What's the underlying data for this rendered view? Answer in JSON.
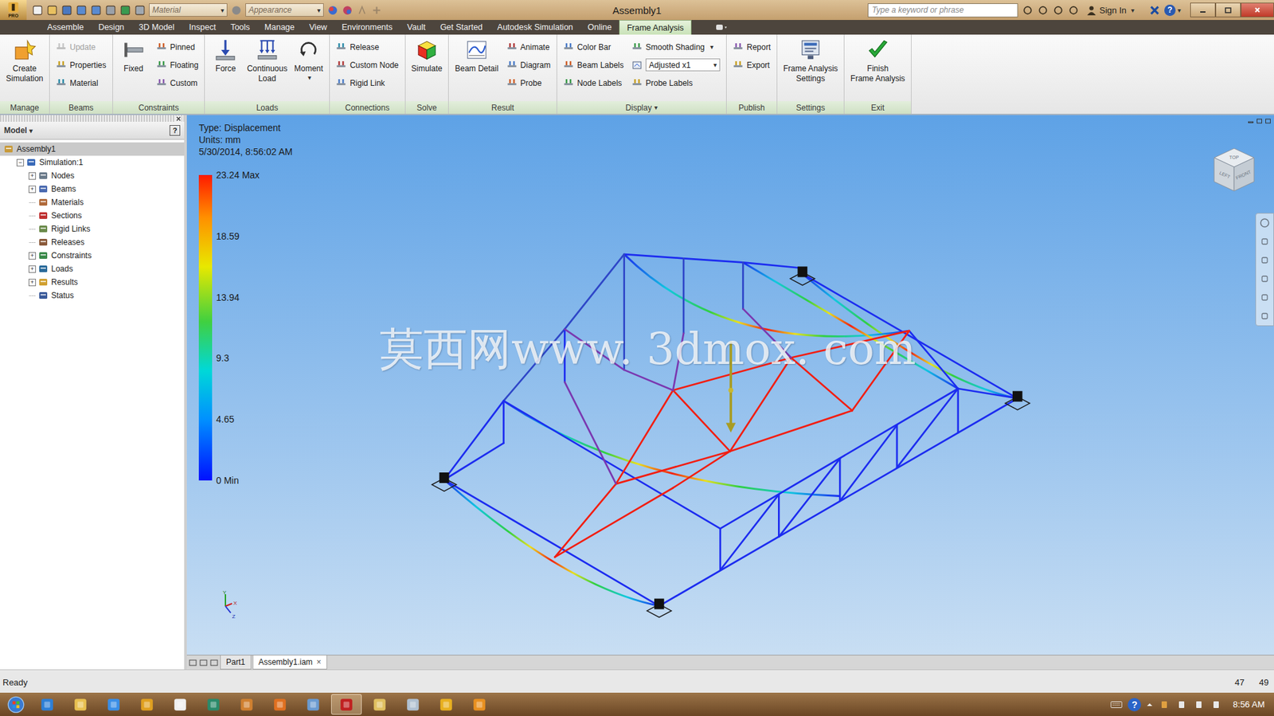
{
  "window": {
    "title": "Assembly1",
    "app_badge": "PRO"
  },
  "quick_access": {
    "material": "Material",
    "appearance": "Appearance",
    "dropdown": "▾"
  },
  "search": {
    "placeholder": "Type a keyword or phrase"
  },
  "account": {
    "sign_in": "Sign In",
    "help": "?",
    "dropdown": "▾"
  },
  "tabs": [
    {
      "label": "Assemble",
      "selected": false
    },
    {
      "label": "Design",
      "selected": false
    },
    {
      "label": "3D Model",
      "selected": false
    },
    {
      "label": "Inspect",
      "selected": false
    },
    {
      "label": "Tools",
      "selected": false
    },
    {
      "label": "Manage",
      "selected": false
    },
    {
      "label": "View",
      "selected": false
    },
    {
      "label": "Environments",
      "selected": false
    },
    {
      "label": "Vault",
      "selected": false
    },
    {
      "label": "Get Started",
      "selected": false
    },
    {
      "label": "Autodesk Simulation",
      "selected": false
    },
    {
      "label": "Online",
      "selected": false
    },
    {
      "label": "Frame Analysis",
      "selected": true
    }
  ],
  "ribbon": {
    "panels": [
      {
        "title": "Manage",
        "groups": [
          {
            "kind": "large",
            "items": [
              {
                "lines": [
                  "Create",
                  "Simulation"
                ],
                "disabled": false
              }
            ]
          }
        ]
      },
      {
        "title": "Beams",
        "groups": [
          {
            "kind": "small",
            "items": [
              {
                "kind": "button",
                "label": "Update",
                "disabled": true
              },
              {
                "kind": "button",
                "label": "Properties",
                "disabled": false
              },
              {
                "kind": "button",
                "label": "Material",
                "disabled": false
              }
            ]
          }
        ]
      },
      {
        "title": "Constraints",
        "groups": [
          {
            "kind": "large",
            "items": [
              {
                "lines": [
                  "Fixed"
                ],
                "disabled": false
              }
            ]
          },
          {
            "kind": "small",
            "items": [
              {
                "kind": "button",
                "label": "Pinned",
                "disabled": false
              },
              {
                "kind": "button",
                "label": "Floating",
                "disabled": false
              },
              {
                "kind": "button",
                "label": "Custom",
                "disabled": false
              }
            ]
          }
        ]
      },
      {
        "title": "Loads",
        "groups": [
          {
            "kind": "large",
            "items": [
              {
                "lines": [
                  "Force"
                ],
                "disabled": false
              },
              {
                "lines": [
                  "Continuous",
                  "Load"
                ],
                "disabled": false
              },
              {
                "lines": [
                  "Moment"
                ],
                "disabled": false,
                "dropdown": "▾"
              }
            ]
          }
        ]
      },
      {
        "title": "Connections",
        "groups": [
          {
            "kind": "small",
            "items": [
              {
                "kind": "button",
                "label": "Release",
                "disabled": false
              },
              {
                "kind": "button",
                "label": "Custom Node",
                "disabled": false
              },
              {
                "kind": "button",
                "label": "Rigid Link",
                "disabled": false
              }
            ]
          }
        ]
      },
      {
        "title": "Solve",
        "groups": [
          {
            "kind": "large",
            "items": [
              {
                "lines": [
                  "Simulate"
                ],
                "disabled": false
              }
            ]
          }
        ]
      },
      {
        "title": "Result",
        "groups": [
          {
            "kind": "large",
            "items": [
              {
                "lines": [
                  "Beam Detail"
                ],
                "disabled": false
              }
            ]
          },
          {
            "kind": "small",
            "items": [
              {
                "kind": "button",
                "label": "Animate",
                "disabled": false
              },
              {
                "kind": "button",
                "label": "Diagram",
                "disabled": false
              },
              {
                "kind": "button",
                "label": "Probe",
                "disabled": false
              }
            ]
          }
        ]
      },
      {
        "title": "Display",
        "dropdown": "▾",
        "groups": [
          {
            "kind": "small",
            "items": [
              {
                "kind": "button",
                "label": "Color Bar",
                "disabled": false
              },
              {
                "kind": "button",
                "label": "Beam Labels",
                "disabled": false
              },
              {
                "kind": "button",
                "label": "Node Labels",
                "disabled": false
              }
            ]
          },
          {
            "kind": "small",
            "items": [
              {
                "kind": "button",
                "label": "Smooth Shading",
                "disabled": false,
                "dropdown": "▾"
              },
              {
                "kind": "combo",
                "label": "Adjusted x1",
                "disabled": false,
                "dropdown": "▾"
              },
              {
                "kind": "button",
                "label": "Probe Labels",
                "disabled": false
              }
            ]
          }
        ]
      },
      {
        "title": "Publish",
        "groups": [
          {
            "kind": "small",
            "items": [
              {
                "kind": "button",
                "label": "Report",
                "disabled": false
              },
              {
                "kind": "button",
                "label": "Export",
                "disabled": false
              }
            ]
          }
        ]
      },
      {
        "title": "Settings",
        "groups": [
          {
            "kind": "large",
            "items": [
              {
                "lines": [
                  "Frame Analysis",
                  "Settings"
                ],
                "disabled": false
              }
            ]
          }
        ]
      },
      {
        "title": "Exit",
        "groups": [
          {
            "kind": "large",
            "items": [
              {
                "lines": [
                  "Finish",
                  "Frame Analysis"
                ],
                "disabled": false
              }
            ]
          }
        ]
      }
    ]
  },
  "browser": {
    "header": "Model",
    "dropdown": "▾",
    "help": "?",
    "items": [
      {
        "label": "Assembly1",
        "depth": 0,
        "expander": null,
        "selected": true
      },
      {
        "label": "Simulation:1",
        "depth": 1,
        "expander": "−",
        "selected": false
      },
      {
        "label": "Nodes",
        "depth": 2,
        "expander": "+",
        "selected": false
      },
      {
        "label": "Beams",
        "depth": 2,
        "expander": "+",
        "selected": false
      },
      {
        "label": "Materials",
        "depth": 2,
        "expander": null,
        "selected": false
      },
      {
        "label": "Sections",
        "depth": 2,
        "expander": null,
        "selected": false
      },
      {
        "label": "Rigid Links",
        "depth": 2,
        "expander": null,
        "selected": false
      },
      {
        "label": "Releases",
        "depth": 2,
        "expander": null,
        "selected": false
      },
      {
        "label": "Constraints",
        "depth": 2,
        "expander": "+",
        "selected": false
      },
      {
        "label": "Loads",
        "depth": 2,
        "expander": "+",
        "selected": false
      },
      {
        "label": "Results",
        "depth": 2,
        "expander": "+",
        "selected": false
      },
      {
        "label": "Status",
        "depth": 2,
        "expander": null,
        "selected": false
      }
    ]
  },
  "viewport": {
    "legend": {
      "type": "Type: Displacement",
      "units": "Units: mm",
      "timestamp": "5/30/2014, 8:56:02 AM",
      "scale": [
        "23.24 Max",
        "18.59",
        "13.94",
        "9.3",
        "4.65",
        "0 Min"
      ]
    },
    "watermark": "莫西网www. 3dmox. com",
    "viewcube": {
      "top": "TOP",
      "left": "LEFT",
      "front": "FRONT"
    },
    "triad": {
      "x": "X",
      "y": "Y",
      "z": "Z"
    }
  },
  "document_tabs": [
    {
      "label": "Part1",
      "selected": false,
      "close": null
    },
    {
      "label": "Assembly1.iam",
      "selected": true,
      "close": "×"
    }
  ],
  "status_bar": {
    "text": "Ready",
    "values": [
      "47",
      "49"
    ]
  },
  "taskbar": {
    "clock": "8:56 AM",
    "help": "?",
    "buttons": [
      {
        "active": false
      },
      {
        "active": false
      },
      {
        "active": false
      },
      {
        "active": false
      },
      {
        "active": false
      },
      {
        "active": false
      },
      {
        "active": false
      },
      {
        "active": false
      },
      {
        "active": false
      },
      {
        "active": true
      },
      {
        "active": false
      },
      {
        "active": false
      },
      {
        "active": false
      },
      {
        "active": false
      }
    ]
  }
}
